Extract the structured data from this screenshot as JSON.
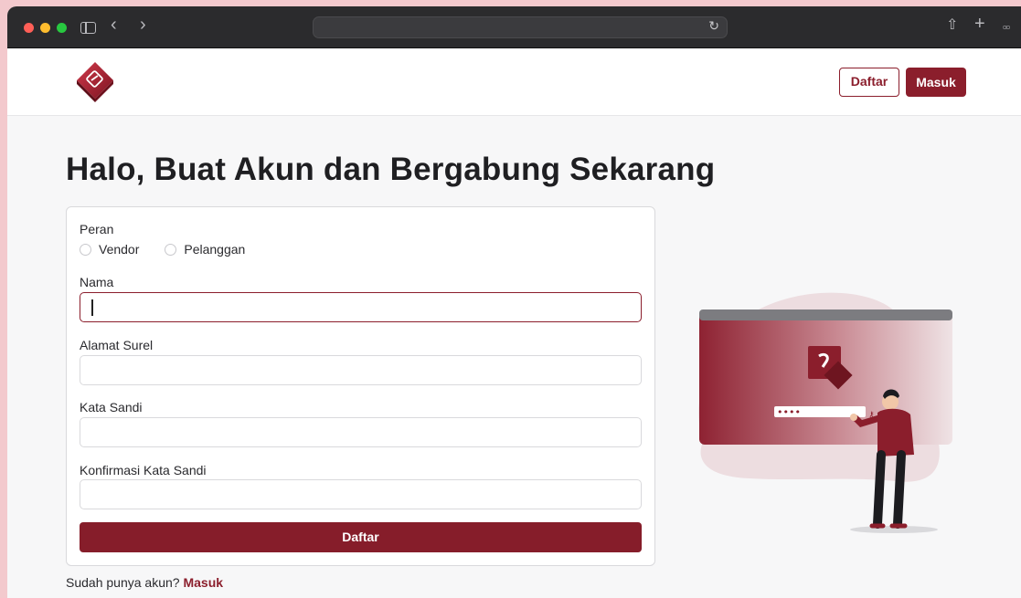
{
  "header": {
    "register_label": "Daftar",
    "login_label": "Masuk"
  },
  "page": {
    "title": "Halo, Buat Akun dan Bergabung Sekarang"
  },
  "form": {
    "role_label": "Peran",
    "role_options": [
      "Vendor",
      "Pelanggan"
    ],
    "name_label": "Nama",
    "name_value": "",
    "email_label": "Alamat Surel",
    "email_value": "",
    "password_label": "Kata Sandi",
    "password_value": "",
    "confirm_label": "Konfirmasi Kata Sandi",
    "confirm_value": "",
    "submit_label": "Daftar"
  },
  "footer": {
    "prompt": "Sudah punya akun?",
    "login_link": "Masuk"
  },
  "colors": {
    "brand": "#8b1e2c",
    "background": "#f7f7f8"
  },
  "illustration": {
    "password_mask": "••••"
  }
}
